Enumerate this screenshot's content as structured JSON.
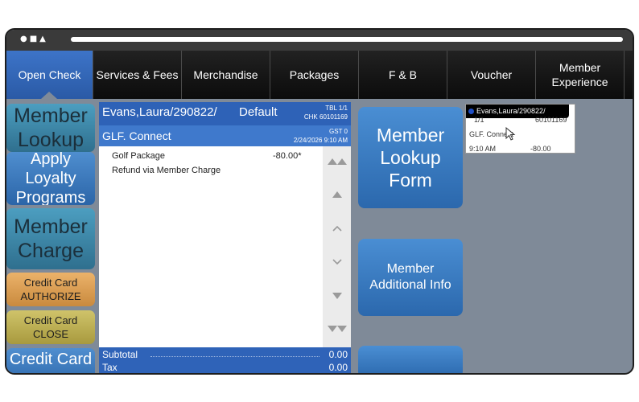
{
  "window": {
    "controls": "●■▲"
  },
  "tabs": [
    {
      "label": "Open Check",
      "active": true
    },
    {
      "label": "Services & Fees"
    },
    {
      "label": "Merchandise"
    },
    {
      "label": "Packages"
    },
    {
      "label": "F & B"
    },
    {
      "label": "Voucher"
    },
    {
      "label": "Member Experience"
    }
  ],
  "left_buttons": {
    "member_lookup": "Member Lookup",
    "apply_loyalty": "Apply Loyalty Programs",
    "member_charge": "Member Charge",
    "cc_authorize_1": "Credit Card",
    "cc_authorize_2": "AUTHORIZE",
    "cc_close_1": "Credit Card",
    "cc_close_2": "CLOSE",
    "credit": "Credit Card"
  },
  "check": {
    "member": "Evans,Laura/290822/",
    "profile": "Default",
    "table": "TBL 1/1",
    "check_no": "CHK 60101169",
    "club": "GLF. Connect",
    "gst": "GST 0",
    "datetime": "2/24/2026 9:10 AM",
    "items": [
      {
        "name": "Golf Package",
        "price": "-80.00*"
      },
      {
        "name": "Refund via Member Charge",
        "price": ""
      }
    ],
    "subtotal_label": "Subtotal",
    "subtotal": "0.00",
    "tax_label": "Tax",
    "tax": "0.00"
  },
  "scroll_icons": [
    "double-up",
    "up",
    "chevron-up",
    "chevron-down",
    "down",
    "double-down"
  ],
  "middle_buttons": {
    "lookup_form": "Member Lookup Form",
    "additional_info": "Member Additional Info"
  },
  "popup": {
    "header": "Evans,Laura/290822/",
    "line1_left": "1/1",
    "line1_right": "60101169",
    "line2": "GLF. Connect",
    "line3_left": "9:10 AM",
    "line3_right": "-80.00"
  },
  "colors": {
    "tab_active": "#3d74c8",
    "check_header": "#2e62b7",
    "panel_bg": "#7f8a98"
  }
}
